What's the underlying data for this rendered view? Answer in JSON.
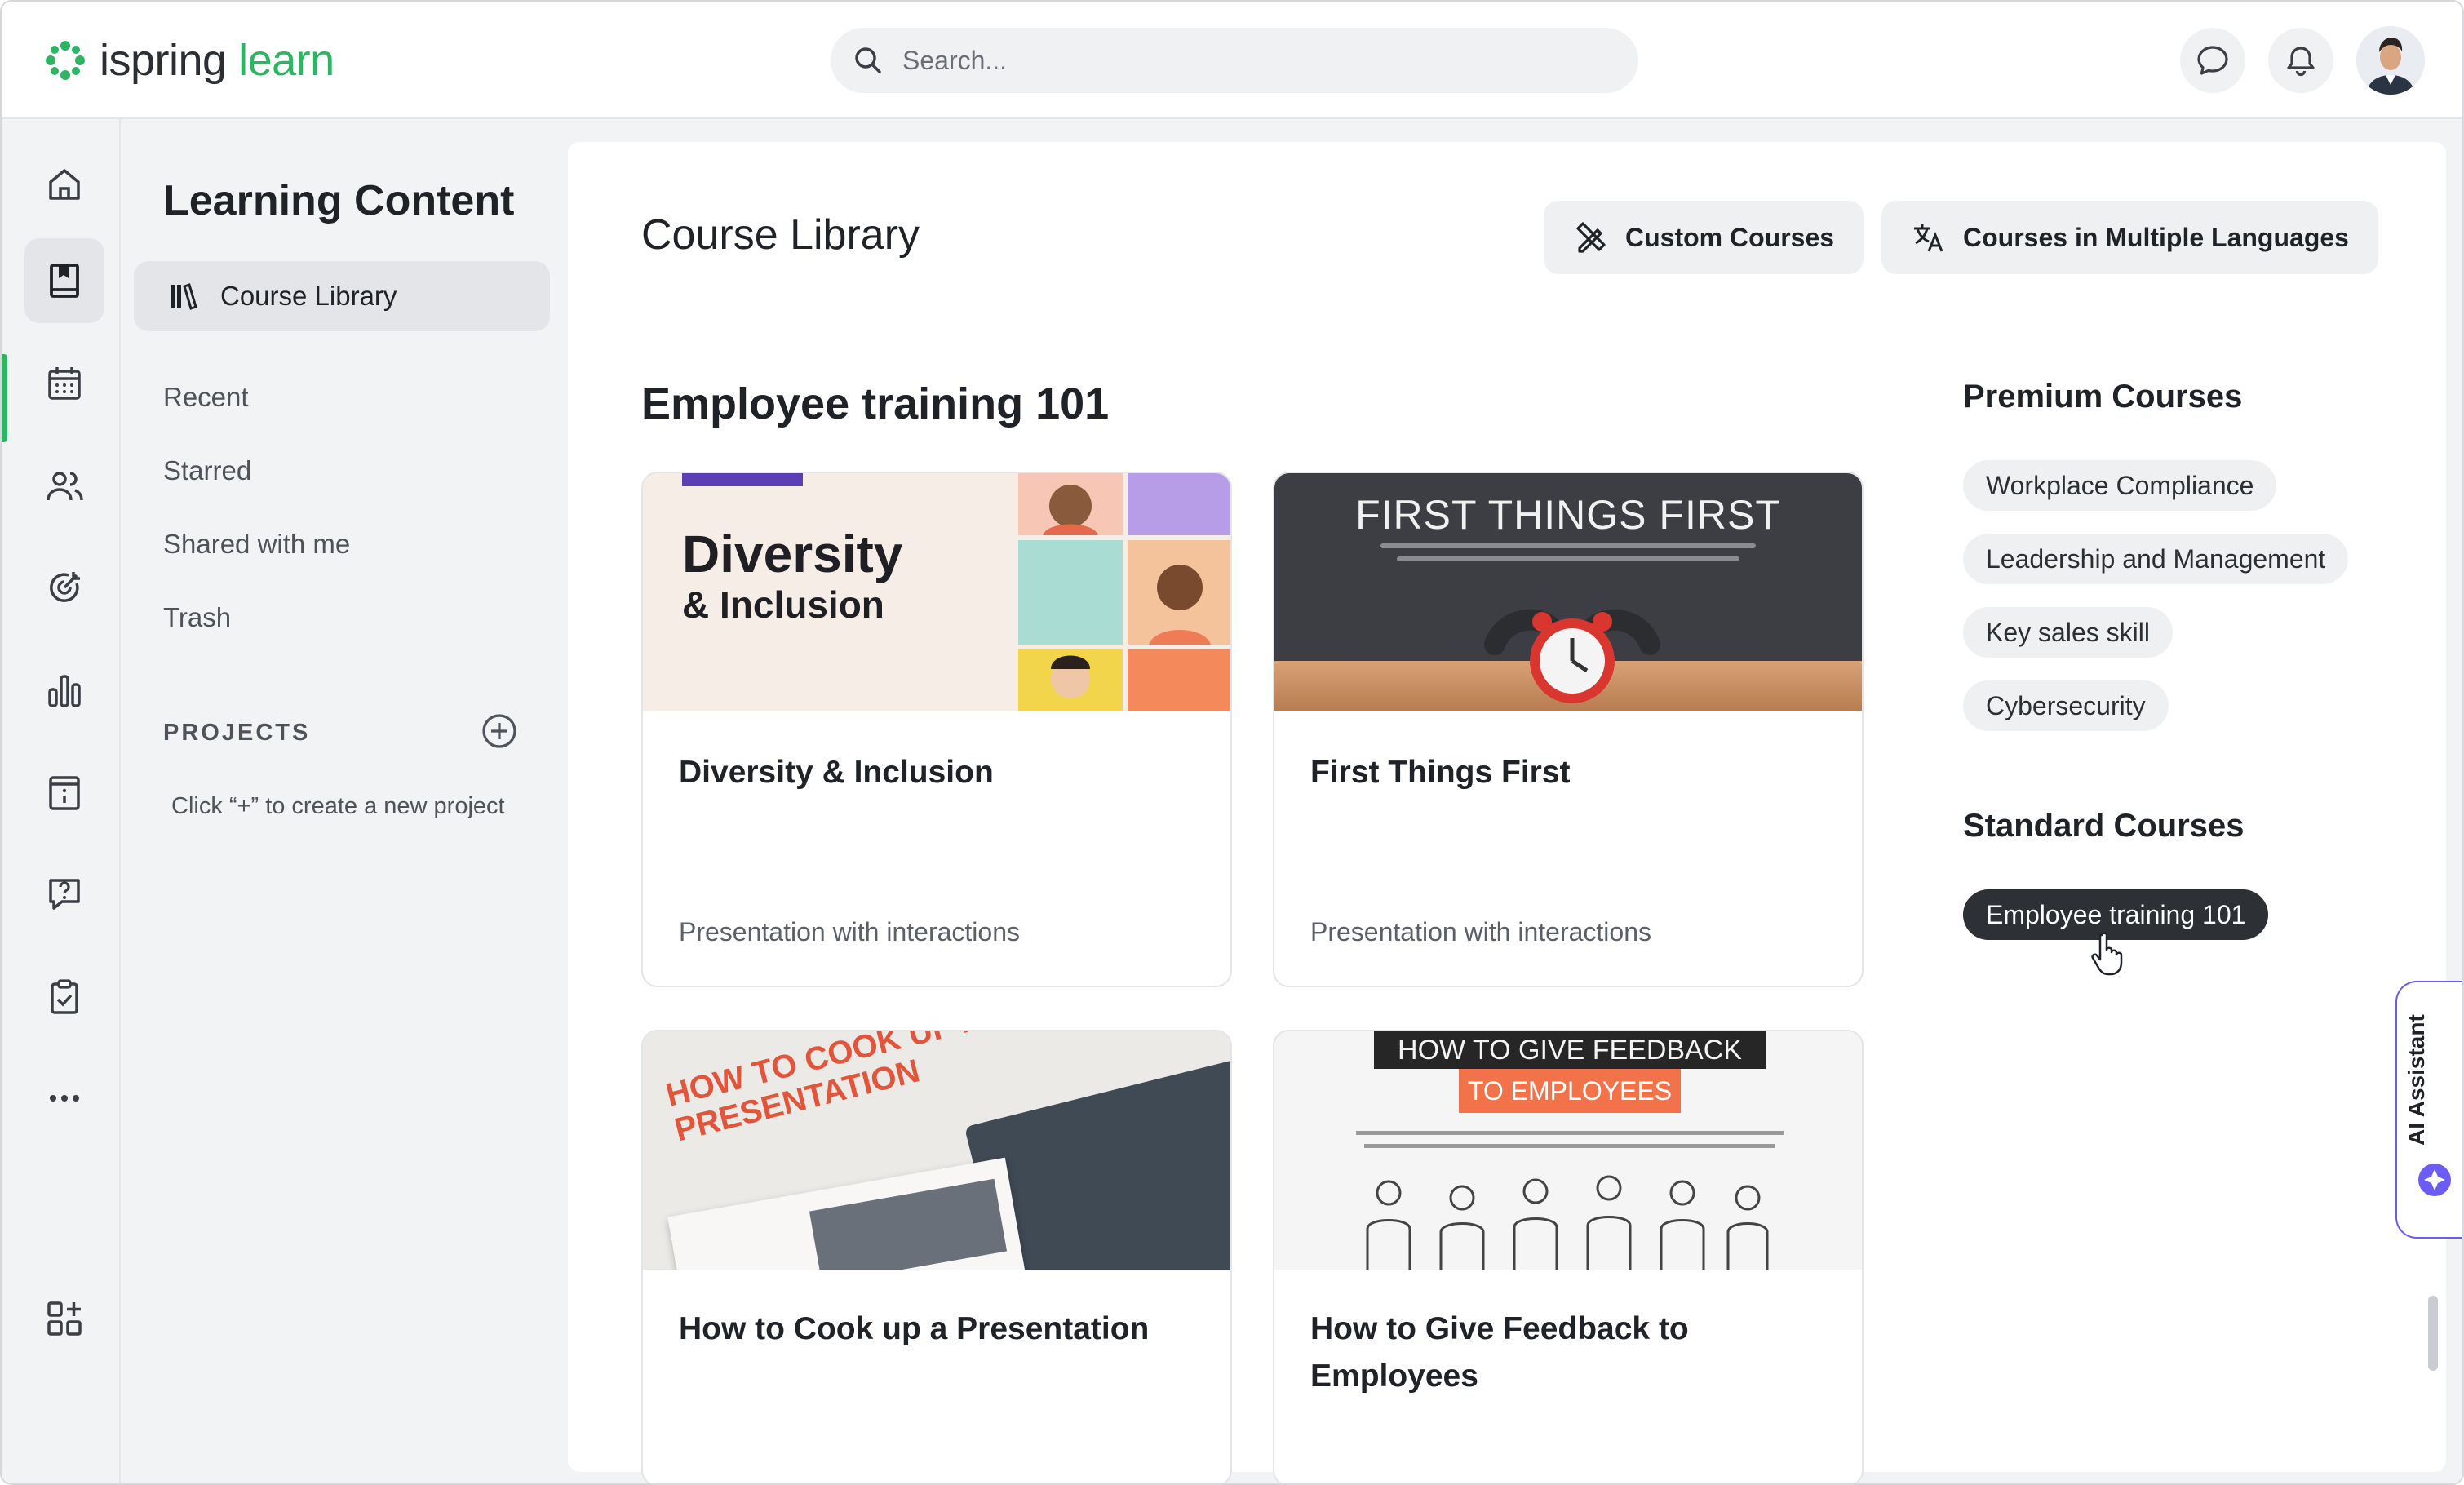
{
  "app": {
    "logo_a": "ispring",
    "logo_b": "learn"
  },
  "search": {
    "placeholder": "Search..."
  },
  "subnav": {
    "title": "Learning Content",
    "active_item": "Course Library",
    "links": [
      "Recent",
      "Starred",
      "Shared with me",
      "Trash"
    ],
    "projects_label": "PROJECTS",
    "projects_hint": "Click “+” to create a new project"
  },
  "main": {
    "page_title": "Course Library",
    "buttons": {
      "custom": "Custom Courses",
      "multilang": "Courses in Multiple Languages"
    },
    "section_title": "Employee training 101",
    "cards": [
      {
        "title": "Diversity & Inclusion",
        "type": "Presentation with interactions",
        "thumb_big": "Diversity",
        "thumb_small": "& Inclusion"
      },
      {
        "title": "First Things First",
        "type": "Presentation with interactions",
        "thumb_heading": "FIRST THINGS FIRST"
      },
      {
        "title": "How to Cook up a Presentation",
        "type": "",
        "thumb_heading": "HOW TO COOK UP A PRESENTATION"
      },
      {
        "title": "How to Give Feedback to Employees",
        "type": "",
        "thumb_line1": "HOW TO GIVE FEEDBACK",
        "thumb_line2": "TO EMPLOYEES"
      }
    ]
  },
  "right": {
    "premium_title": "Premium Courses",
    "premium": [
      "Workplace Compliance",
      "Leadership and Management",
      "Key sales skill",
      "Cybersecurity"
    ],
    "standard_title": "Standard Courses",
    "standard": [
      "Employee training 101"
    ]
  },
  "ai": {
    "label": "AI Assistant"
  },
  "colors": {
    "brand_green": "#2fb463",
    "ai_purple": "#6b5cf6",
    "active_chip": "#2d3136"
  }
}
